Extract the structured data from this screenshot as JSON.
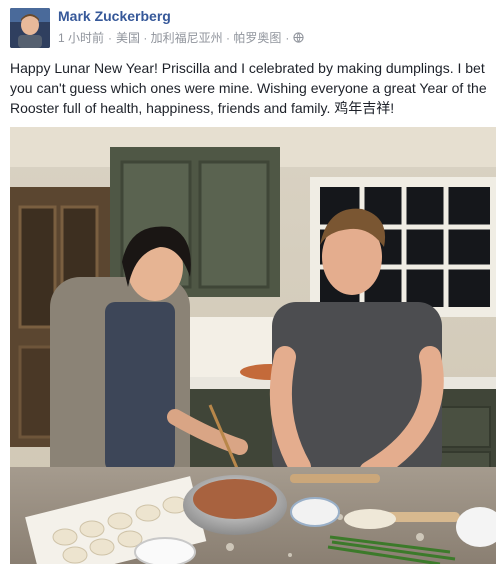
{
  "post": {
    "author": "Mark Zuckerberg",
    "timestamp": "1 小时前",
    "location": "美国 · 加利福尼亚州 · 帕罗奥图",
    "separator": "·",
    "privacy_icon": "globe-icon",
    "text": "Happy Lunar New Year! Priscilla and I celebrated by making dumplings. I bet you can't guess which ones were mine. Wishing everyone a great Year of the Rooster full of health, happiness, friends and family.",
    "text_suffix": "鸡年吉祥!"
  },
  "colors": {
    "author_link": "#365899",
    "meta_text": "#90949c",
    "body_text": "#1d2129"
  }
}
